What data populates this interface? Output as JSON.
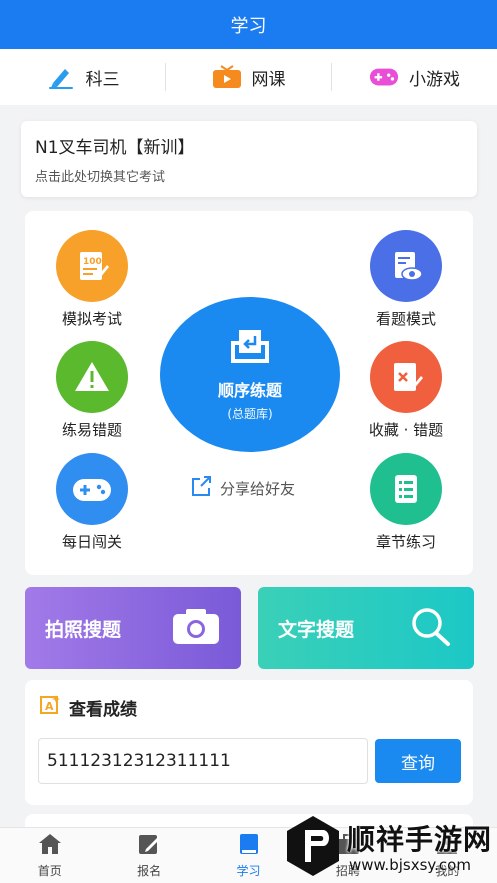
{
  "header": {
    "title": "学习"
  },
  "subnav": [
    {
      "label": "科三",
      "icon": "pen-icon"
    },
    {
      "label": "网课",
      "icon": "tv-icon"
    },
    {
      "label": "小游戏",
      "icon": "gamepad-icon"
    }
  ],
  "exam": {
    "title": "N1叉车司机【新训】",
    "subtitle": "点击此处切换其它考试"
  },
  "features": {
    "mock_exam": "模拟考试",
    "view_mode": "看题模式",
    "easy_errors": "练易错题",
    "favorites_errors": "收藏 · 错题",
    "daily_challenge": "每日闯关",
    "chapter_practice": "章节练习",
    "sequential": {
      "title": "顺序练题",
      "subtitle": "(总题库)"
    },
    "share": "分享给好友"
  },
  "search": {
    "photo_label": "拍照搜题",
    "text_label": "文字搜题"
  },
  "score": {
    "title": "查看成绩",
    "input_value": "51112312312311111",
    "button": "查询"
  },
  "bottom_nav": [
    {
      "label": "首页",
      "icon": "home-icon"
    },
    {
      "label": "报名",
      "icon": "edit-icon"
    },
    {
      "label": "学习",
      "icon": "book-icon",
      "active": true
    },
    {
      "label": "招聘",
      "icon": "briefcase-icon"
    },
    {
      "label": "我的",
      "icon": "user-icon"
    }
  ],
  "watermark": {
    "name": "顺祥手游网",
    "url": "www.bjsxsy.com"
  },
  "colors": {
    "primary": "#1a7cf0",
    "mock": "#f7a12a",
    "view": "#4a6fe6",
    "easy": "#5ab92c",
    "fav": "#f0603e",
    "daily": "#2f8ef0",
    "chapter": "#1fbf8f"
  }
}
